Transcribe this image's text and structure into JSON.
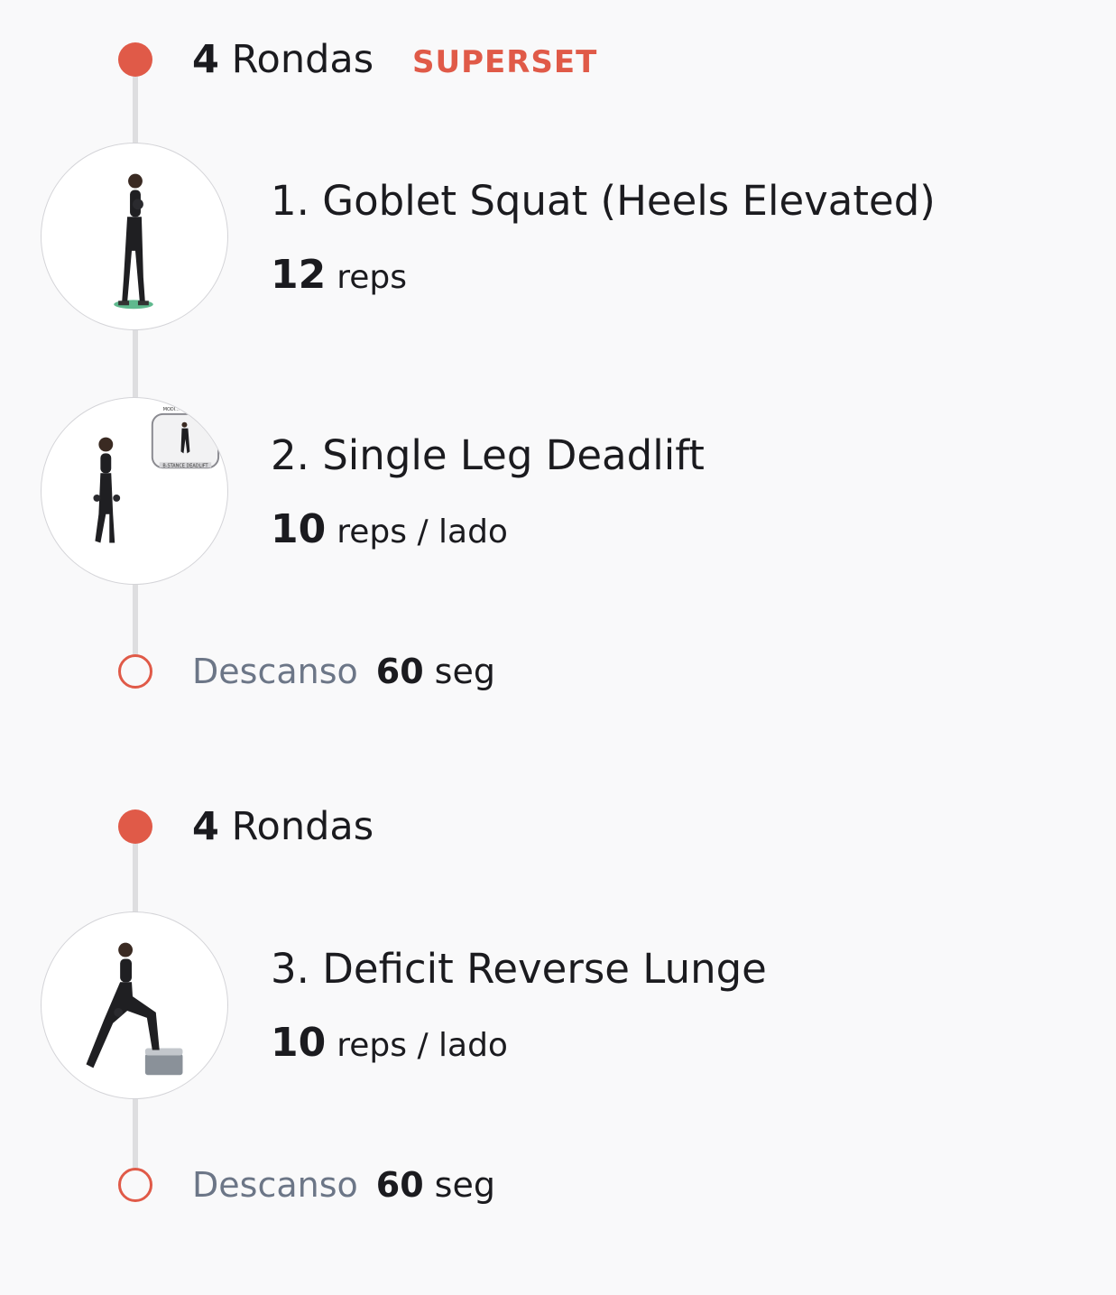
{
  "colors": {
    "accent": "#e05a48",
    "muted": "#6c7687",
    "line": "#dedee0"
  },
  "blocks": [
    {
      "rounds_count": "4",
      "rounds_label": "Rondas",
      "tag": "SUPERSET",
      "exercises": [
        {
          "title": "1. Goblet Squat (Heels Elevated)",
          "amount": "12",
          "unit": "reps",
          "image_icon": "goblet-squat-thumbnail"
        },
        {
          "title": "2. Single Leg Deadlift",
          "amount": "10",
          "unit": "reps / lado",
          "image_icon": "single-leg-deadlift-thumbnail",
          "inset_caption": "B-STANCE DEADLIFT",
          "inset_badge": "MODI..."
        }
      ],
      "rest": {
        "label": "Descanso",
        "value": "60",
        "unit": "seg"
      }
    },
    {
      "rounds_count": "4",
      "rounds_label": "Rondas",
      "exercises": [
        {
          "title": "3. Deficit Reverse Lunge",
          "amount": "10",
          "unit": "reps / lado",
          "image_icon": "deficit-reverse-lunge-thumbnail"
        }
      ],
      "rest": {
        "label": "Descanso",
        "value": "60",
        "unit": "seg"
      }
    }
  ]
}
